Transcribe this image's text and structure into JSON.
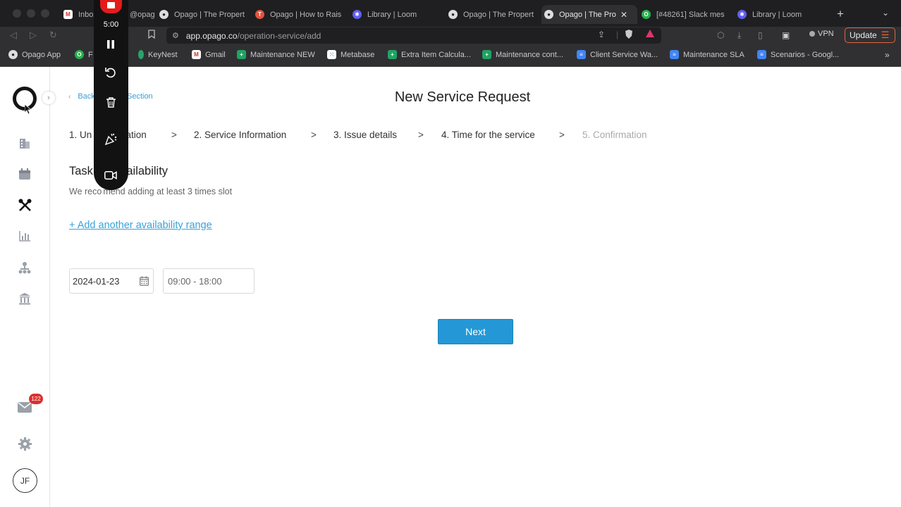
{
  "browser": {
    "tabs": [
      {
        "label": "Inbox",
        "icon": "gmail-icon",
        "color": "#d93025"
      },
      {
        "label": "@opag",
        "icon": "",
        "color": ""
      },
      {
        "label": "Opago | The Propert",
        "icon": "github-icon",
        "color": "#222"
      },
      {
        "label": "Opago | How to Rais",
        "icon": "tribe-icon",
        "color": "#e0533f"
      },
      {
        "label": "Library | Loom",
        "icon": "loom-icon",
        "color": "#625df5"
      },
      {
        "label": "Opago | The Propert",
        "icon": "github-icon",
        "color": "#222"
      },
      {
        "label": "Opago | The Pro",
        "icon": "github-icon",
        "color": "#222"
      },
      {
        "label": "[#48261] Slack mes",
        "icon": "opago-icon",
        "color": "#28b04d"
      },
      {
        "label": "Library | Loom",
        "icon": "loom-icon",
        "color": "#625df5"
      }
    ],
    "tab_close": "✕",
    "new_tab": "+",
    "url_host": "app.opago.co",
    "url_path": "/operation-service/add",
    "vpn_label": "VPN",
    "update_label": "Update",
    "bookmarks": [
      {
        "label": "Opago App",
        "icon": "github-icon",
        "color": "#222"
      },
      {
        "label": "F",
        "icon": "opago-icon",
        "color": "#28b04d"
      },
      {
        "label": "KeyNest",
        "icon": "keynest-icon",
        "color": "#2aa36a"
      },
      {
        "label": "Gmail",
        "icon": "gmail-icon",
        "color": "#d93025"
      },
      {
        "label": "Maintenance NEW",
        "icon": "sheets-icon",
        "color": "#1fa463"
      },
      {
        "label": "Metabase",
        "icon": "metabase-icon",
        "color": "#509ee3"
      },
      {
        "label": "Extra Item Calcula...",
        "icon": "sheets-icon",
        "color": "#1fa463"
      },
      {
        "label": "Maintenance cont...",
        "icon": "sheets-icon",
        "color": "#1fa463"
      },
      {
        "label": "Client Service Wa...",
        "icon": "docs-icon",
        "color": "#4285f4"
      },
      {
        "label": "Maintenance SLA",
        "icon": "docs-icon",
        "color": "#4285f4"
      },
      {
        "label": "Scenarios - Googl...",
        "icon": "docs-icon",
        "color": "#4285f4"
      }
    ]
  },
  "recorder": {
    "time": "5:00"
  },
  "sidebar": {
    "badge_count": "122",
    "avatar_initials": "JF"
  },
  "main": {
    "back_link": "Back to Service Section",
    "back_link_visible_left": "Back",
    "back_link_visible_right": "e Section",
    "title": "New Service Request",
    "steps": [
      "1. Unit Information",
      "2. Service Information",
      "3. Issue details",
      "4. Time for the service",
      "5. Confirmation"
    ],
    "step_visible_1": "1. Un",
    "step_visible_1_tail": "mation",
    "step_separator": ">",
    "section_title_left": "Task",
    "section_title_right": "availability",
    "section_desc_left": "We reco",
    "section_desc_right": "mend adding at least 3 times slot",
    "add_range": "+ Add another availability range",
    "date_value": "2024-01-23",
    "time_value": "09:00 - 18:00",
    "next_label": "Next"
  },
  "colors": {
    "accent": "#2498d6",
    "link": "#39a2d6",
    "badge": "#d9302e",
    "record": "#e21b1b"
  }
}
